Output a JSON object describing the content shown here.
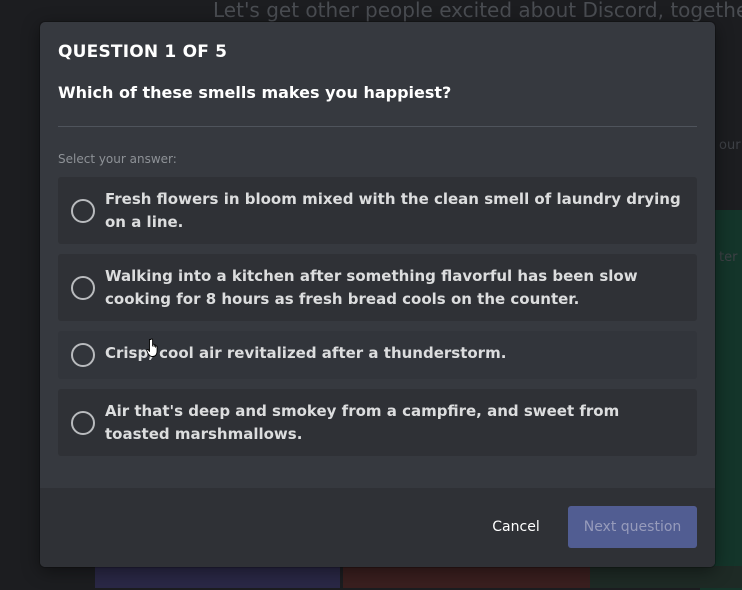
{
  "background": {
    "headline": "Let's get other people excited about Discord, together.",
    "side_text_1": "our",
    "side_text_2": "ter"
  },
  "quiz": {
    "counter": "QUESTION 1 OF 5",
    "question": "Which of these smells makes you happiest?",
    "select_label": "Select your answer:",
    "answers": [
      {
        "label": "Fresh flowers in bloom mixed with the clean smell of laundry drying on a line.",
        "selected": false
      },
      {
        "label": "Walking into a kitchen after something flavorful has been slow cooking for 8 hours as fresh bread cools on the counter.",
        "selected": false
      },
      {
        "label": "Crisp, cool air revitalized after a thunderstorm.",
        "selected": false
      },
      {
        "label": "Air that's deep and smokey from a campfire, and sweet from toasted marshmallows.",
        "selected": false
      }
    ]
  },
  "footer": {
    "cancel_label": "Cancel",
    "next_label": "Next question",
    "next_enabled": false
  },
  "colors": {
    "modal_bg": "#36393f",
    "answer_bg": "#2f3136",
    "accent_disabled": "#5865a3"
  },
  "icons": {
    "radio": "radio-unchecked-icon",
    "cursor": "hand-pointer-icon"
  }
}
